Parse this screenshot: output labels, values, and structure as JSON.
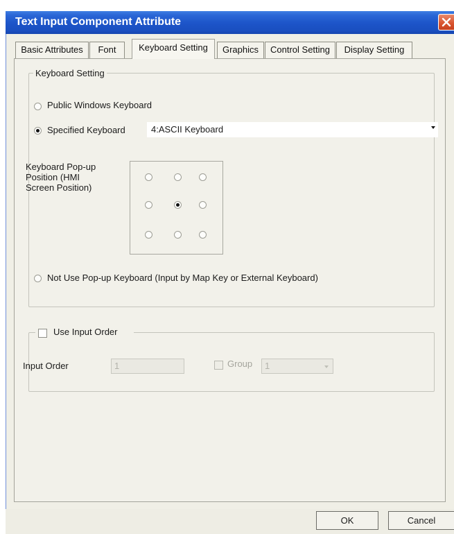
{
  "window": {
    "title": "Text Input Component Attribute"
  },
  "tabs": [
    {
      "label": "Basic Attributes",
      "active": false
    },
    {
      "label": "Font",
      "active": false
    },
    {
      "label": "Keyboard Setting",
      "active": true
    },
    {
      "label": "Graphics",
      "active": false
    },
    {
      "label": "Control Setting",
      "active": false
    },
    {
      "label": "Display Setting",
      "active": false
    }
  ],
  "keyboard_group": {
    "legend": "Keyboard Setting",
    "public_windows_label": "Public Windows Keyboard",
    "specified_label": "Specified Keyboard",
    "specified_value": "4:ASCII Keyboard",
    "popup_position_label": "Keyboard Pop-up Position (HMI Screen Position)",
    "popup_position_selected": "center",
    "not_use_label": "Not Use Pop-up Keyboard (Input by Map Key or External Keyboard)",
    "selected_option": "specified"
  },
  "input_order_group": {
    "legend": "Use Input Order",
    "checked": false,
    "input_order_label": "Input Order",
    "input_order_value": "1",
    "group_label": "Group",
    "group_checked": false,
    "group_value": "1"
  },
  "buttons": {
    "ok": "OK",
    "cancel": "Cancel"
  },
  "colors": {
    "title_bar": "#1c54c8",
    "close_button": "#d8522d",
    "dialog_bg": "#f2f1ea"
  }
}
